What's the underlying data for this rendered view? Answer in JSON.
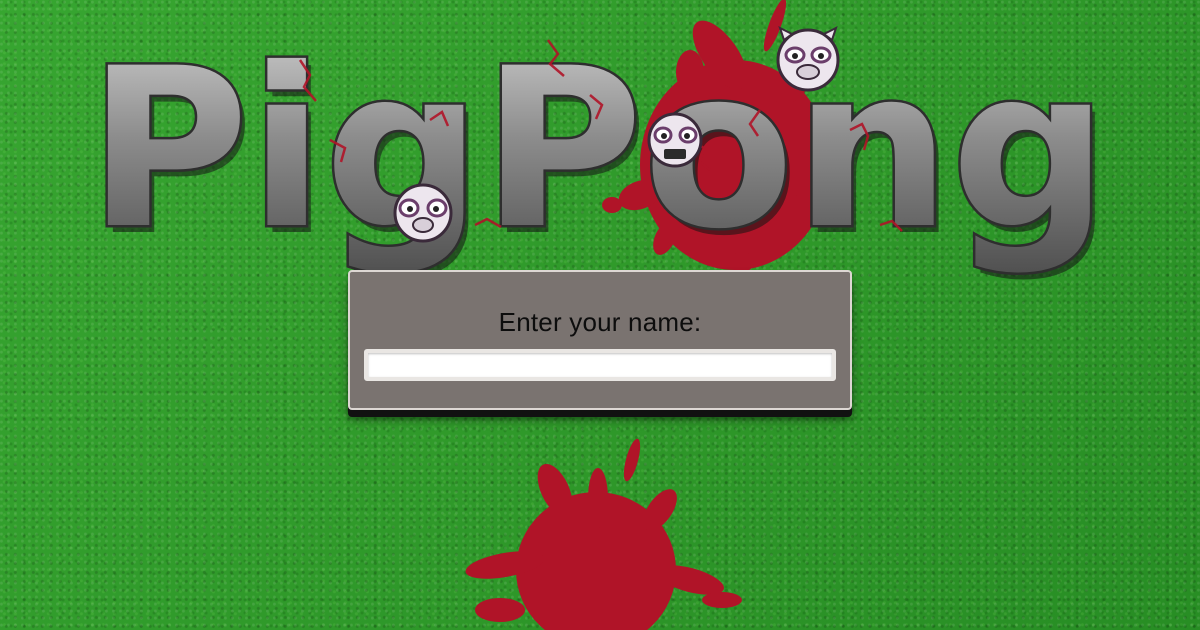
{
  "logo": {
    "title": "PigPong"
  },
  "name_prompt": {
    "label": "Enter your name:",
    "input_value": "",
    "input_placeholder": ""
  },
  "colors": {
    "grass": "#2f9e2a",
    "blood": "#b01428",
    "panel": "#7a7370",
    "stone": "#8e8e8e"
  },
  "icons": [
    "pig-face-icon",
    "blood-splatter-icon"
  ]
}
